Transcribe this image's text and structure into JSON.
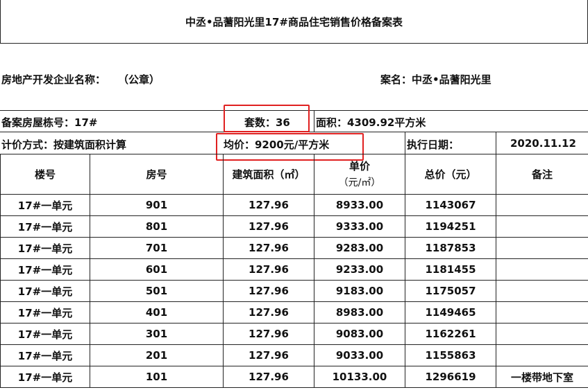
{
  "title": "中丞•品蓍阳光里17#商品住宅销售价格备案表",
  "developer_label": "房地产开发企业名称：",
  "developer_seal": "（公章）",
  "case_name": "案名：中丞•品蓍阳光里",
  "building_no": "备案房屋栋号：17#",
  "unit_count": "套数：36",
  "area": "面积：4309.92平方米",
  "pricing_method": "计价方式：按建筑面积计算",
  "avg_price": "均价：9200元/平方米",
  "effective_date_label": "执行日期：",
  "effective_date": "2020.11.12",
  "table": {
    "headers": {
      "building": "楼号",
      "room": "房号",
      "area": "建筑面积（㎡）",
      "unit_price_line1": "单价",
      "unit_price_line2": "（元/㎡）",
      "total_price": "总价（元）",
      "remark": "备注"
    },
    "rows": [
      {
        "building": "17#一单元",
        "room": "901",
        "area": "127.96",
        "unit_price": "8933.00",
        "total": "1143067",
        "remark": ""
      },
      {
        "building": "17#一单元",
        "room": "801",
        "area": "127.96",
        "unit_price": "9333.00",
        "total": "1194251",
        "remark": ""
      },
      {
        "building": "17#一单元",
        "room": "701",
        "area": "127.96",
        "unit_price": "9283.00",
        "total": "1187853",
        "remark": ""
      },
      {
        "building": "17#一单元",
        "room": "601",
        "area": "127.96",
        "unit_price": "9233.00",
        "total": "1181455",
        "remark": ""
      },
      {
        "building": "17#一单元",
        "room": "501",
        "area": "127.96",
        "unit_price": "9183.00",
        "total": "1175057",
        "remark": ""
      },
      {
        "building": "17#一单元",
        "room": "401",
        "area": "127.96",
        "unit_price": "8983.00",
        "total": "1149465",
        "remark": ""
      },
      {
        "building": "17#一单元",
        "room": "301",
        "area": "127.96",
        "unit_price": "9083.00",
        "total": "1162261",
        "remark": ""
      },
      {
        "building": "17#一单元",
        "room": "201",
        "area": "127.96",
        "unit_price": "9033.00",
        "total": "1155863",
        "remark": ""
      },
      {
        "building": "17#一单元",
        "room": "101",
        "area": "127.96",
        "unit_price": "10133.00",
        "total": "1296619",
        "remark": "一楼带地下室"
      }
    ]
  },
  "highlight_color": "#e02020"
}
